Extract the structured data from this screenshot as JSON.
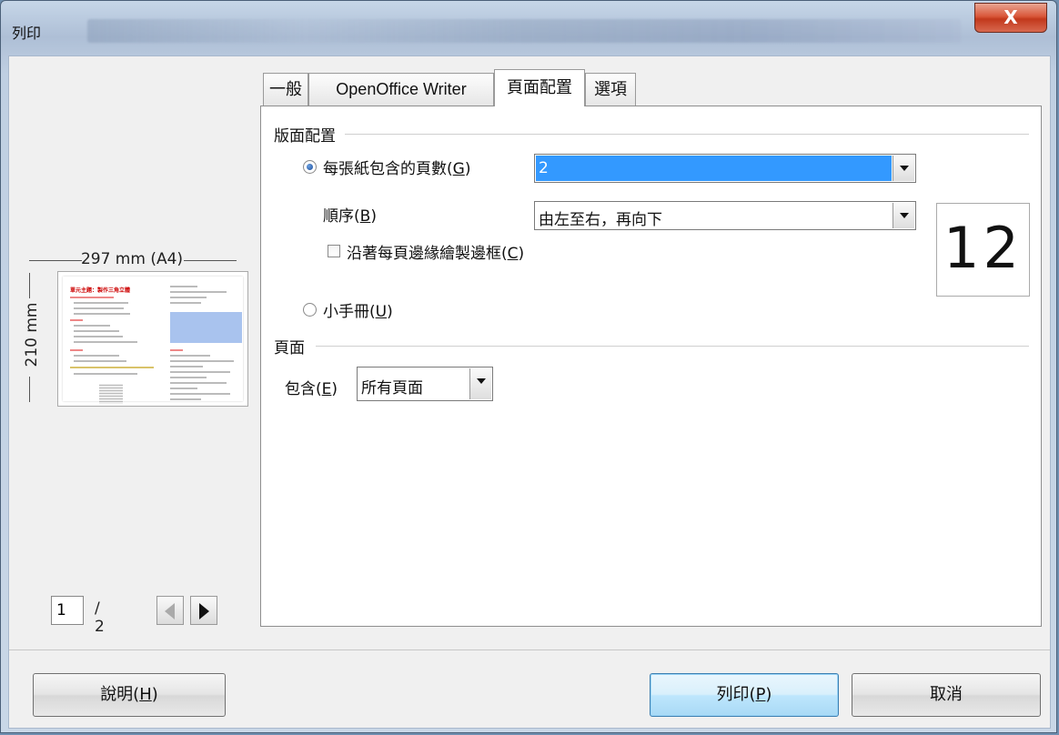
{
  "window": {
    "title": "列印",
    "close_label": "X"
  },
  "preview": {
    "width_label": "297 mm (A4)",
    "height_label": "210 mm",
    "thumbnail_title": "單元主題：製作三角立體",
    "page_current": "1",
    "page_total": "/ 2"
  },
  "tabs": [
    {
      "label": "一般"
    },
    {
      "label": "OpenOffice Writer"
    },
    {
      "label": "頁面配置",
      "active": true
    },
    {
      "label": "選項"
    }
  ],
  "layout_section": {
    "title": "版面配置",
    "pages_per_sheet": {
      "label_prefix": "每張紙包含的頁數(",
      "mnemonic": "G",
      "label_suffix": ")",
      "value": "2",
      "checked": true
    },
    "order": {
      "label_prefix": "順序(",
      "mnemonic": "B",
      "label_suffix": ")",
      "value": "由左至右，再向下"
    },
    "draw_border": {
      "label_prefix": "沿著每頁邊緣繪製邊框(",
      "mnemonic": "C",
      "label_suffix": ")",
      "checked": false
    },
    "brochure": {
      "label_prefix": "小手冊(",
      "mnemonic": "U",
      "label_suffix": ")",
      "checked": false
    },
    "order_preview": "12"
  },
  "page_section": {
    "title": "頁面",
    "include": {
      "label_prefix": "包含(",
      "mnemonic": "E",
      "label_suffix": ")",
      "value": "所有頁面"
    }
  },
  "buttons": {
    "help": {
      "prefix": "說明(",
      "mnemonic": "H",
      "suffix": ")"
    },
    "print": {
      "prefix": "列印(",
      "mnemonic": "P",
      "suffix": ")"
    },
    "cancel": {
      "label": "取消"
    }
  },
  "colors": {
    "selection": "#3399ff",
    "close_button": "#c94a2f",
    "default_button": "#bee6fd"
  },
  "icons": {
    "close": "close-icon",
    "prev": "arrow-left-icon",
    "next": "arrow-right-icon",
    "dropdown": "chevron-down-icon"
  }
}
